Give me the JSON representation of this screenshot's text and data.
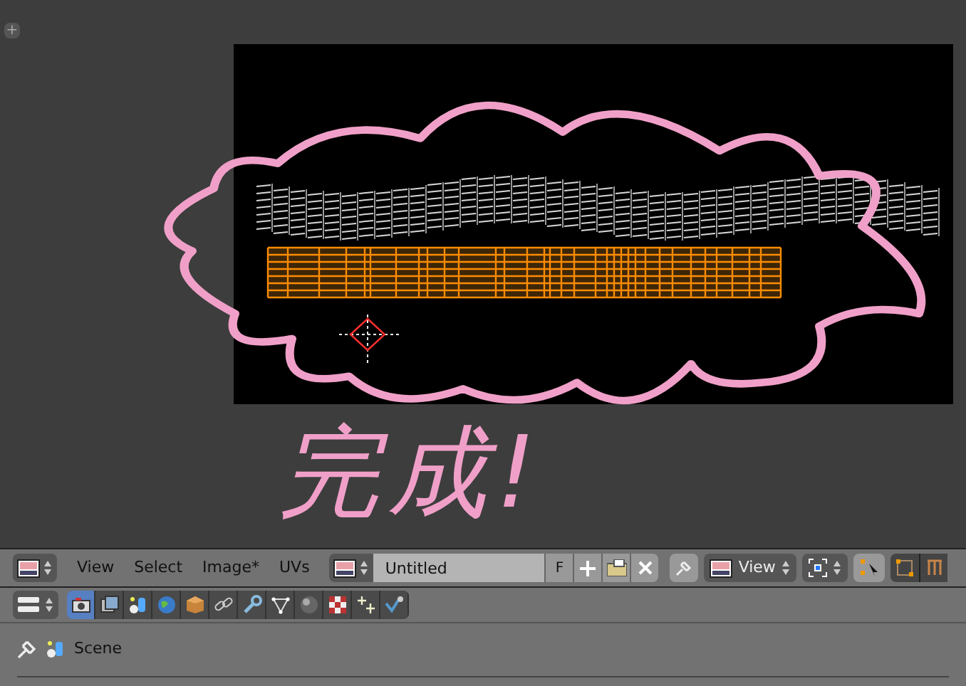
{
  "viewport": {
    "region_toggle": "+",
    "annotation": "完成!"
  },
  "header": {
    "menus": [
      "View",
      "Select",
      "Image*",
      "UVs"
    ],
    "image_name": "Untitled",
    "fake_user": "F",
    "view_mode": "View"
  },
  "properties": {
    "tabs": [
      {
        "kind": "render",
        "selected": true
      },
      {
        "kind": "layers",
        "selected": false
      },
      {
        "kind": "scene",
        "selected": false
      },
      {
        "kind": "world",
        "selected": false
      },
      {
        "kind": "object",
        "selected": false
      },
      {
        "kind": "constraints",
        "selected": false
      },
      {
        "kind": "modifiers",
        "selected": false
      },
      {
        "kind": "data",
        "selected": false
      },
      {
        "kind": "material",
        "selected": false
      },
      {
        "kind": "texture",
        "selected": false
      },
      {
        "kind": "particles",
        "selected": false
      },
      {
        "kind": "physics",
        "selected": false
      }
    ],
    "context": "Scene"
  }
}
